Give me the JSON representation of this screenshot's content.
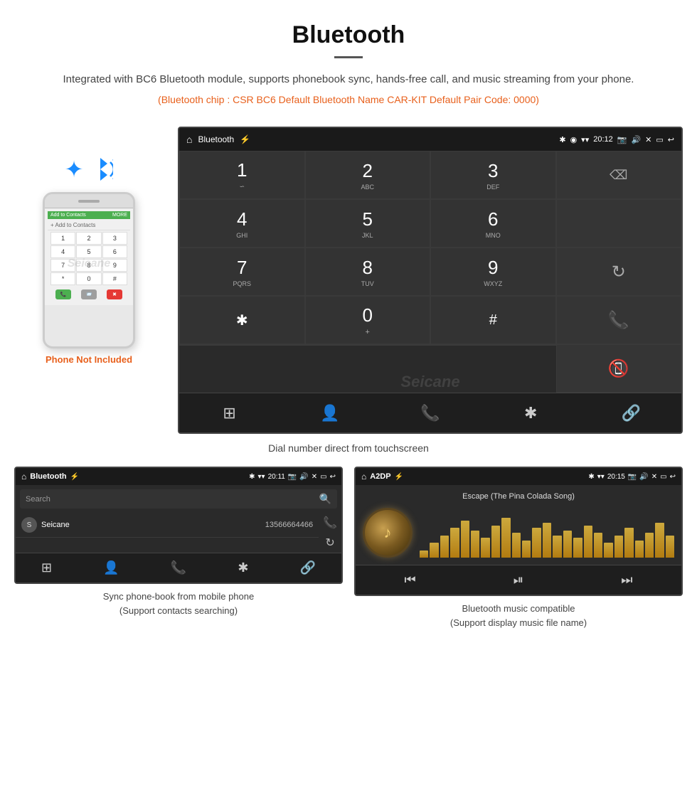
{
  "header": {
    "title": "Bluetooth",
    "description": "Integrated with BC6 Bluetooth module, supports phonebook sync, hands-free call, and music streaming from your phone.",
    "specs": "(Bluetooth chip : CSR BC6    Default Bluetooth Name CAR-KIT    Default Pair Code: 0000)"
  },
  "phone_aside": {
    "not_included_label": "Phone Not Included"
  },
  "head_unit": {
    "status_bar": {
      "app_name": "Bluetooth",
      "time": "20:12",
      "usb_icon": "⚡",
      "bt_icon": "✱",
      "location_icon": "◉",
      "signal_icon": "▾",
      "camera_icon": "📷",
      "volume_icon": "🔊"
    },
    "dialpad": {
      "keys": [
        {
          "num": "1",
          "letters": "∽"
        },
        {
          "num": "2",
          "letters": "ABC"
        },
        {
          "num": "3",
          "letters": "DEF"
        },
        {
          "num": "",
          "letters": "",
          "special": "⌫"
        },
        {
          "num": "4",
          "letters": "GHI"
        },
        {
          "num": "5",
          "letters": "JKL"
        },
        {
          "num": "6",
          "letters": "MNO"
        },
        {
          "num": "",
          "letters": "",
          "special": ""
        },
        {
          "num": "7",
          "letters": "PQRS"
        },
        {
          "num": "8",
          "letters": "TUV"
        },
        {
          "num": "9",
          "letters": "WXYZ"
        },
        {
          "num": "",
          "letters": "",
          "special": "↻"
        },
        {
          "num": "★",
          "letters": ""
        },
        {
          "num": "0",
          "letters": "+"
        },
        {
          "num": "#",
          "letters": ""
        },
        {
          "num": "",
          "letters": "",
          "special": ""
        }
      ]
    },
    "bottom_bar_icons": [
      "⊞",
      "👤",
      "📞",
      "✱",
      "🔗"
    ]
  },
  "dial_caption": "Dial number direct from touchscreen",
  "phonebook_panel": {
    "status_bar": {
      "app_name": "Bluetooth",
      "time": "20:11",
      "bt_icon": "✱"
    },
    "search_placeholder": "Search",
    "contacts": [
      {
        "initial": "S",
        "name": "Seicane",
        "number": "13566664466"
      }
    ],
    "caption_line1": "Sync phone-book from mobile phone",
    "caption_line2": "(Support contacts searching)"
  },
  "music_panel": {
    "status_bar": {
      "app_name": "A2DP",
      "time": "20:15",
      "bt_icon": "✱"
    },
    "song_title": "Escape (The Pina Colada Song)",
    "bars": [
      15,
      30,
      45,
      60,
      75,
      55,
      40,
      65,
      80,
      50,
      35,
      60,
      70,
      45,
      55,
      40,
      65,
      50,
      30,
      45,
      60,
      35,
      50,
      70,
      45
    ],
    "caption_line1": "Bluetooth music compatible",
    "caption_line2": "(Support display music file name)"
  },
  "watermark": "Seicane"
}
